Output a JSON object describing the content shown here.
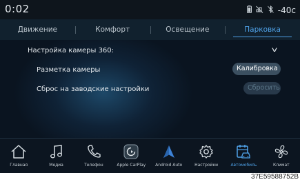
{
  "status": {
    "time": "0:02",
    "temperature": "-40с"
  },
  "tabs": [
    {
      "label": "Движение"
    },
    {
      "label": "Комфорт"
    },
    {
      "label": "Освещение"
    },
    {
      "label": "Парковка"
    }
  ],
  "active_tab": "Парковка",
  "section": {
    "title": "Настройка камеры 360:"
  },
  "settings": [
    {
      "label": "Разметка камеры",
      "button": "Калибровка"
    },
    {
      "label": "Сброс на заводские настройки",
      "button": "Сбросить"
    }
  ],
  "dock": [
    {
      "label": "Главная",
      "icon": "home-icon"
    },
    {
      "label": "Медиа",
      "icon": "music-note-icon"
    },
    {
      "label": "Телефон",
      "icon": "phone-icon"
    },
    {
      "label": "Apple CarPlay",
      "icon": "carplay-icon"
    },
    {
      "label": "Android Auto",
      "icon": "android-auto-icon"
    },
    {
      "label": "Настройки",
      "icon": "gear-icon"
    },
    {
      "label": "Автомобиль",
      "icon": "car-settings-icon"
    },
    {
      "label": "Климат",
      "icon": "fan-icon"
    }
  ],
  "active_dock_item": "Автомобиль",
  "colors": {
    "accent": "#4fa2e8",
    "background": "#0f2236"
  },
  "image_code": "37E59588752B"
}
